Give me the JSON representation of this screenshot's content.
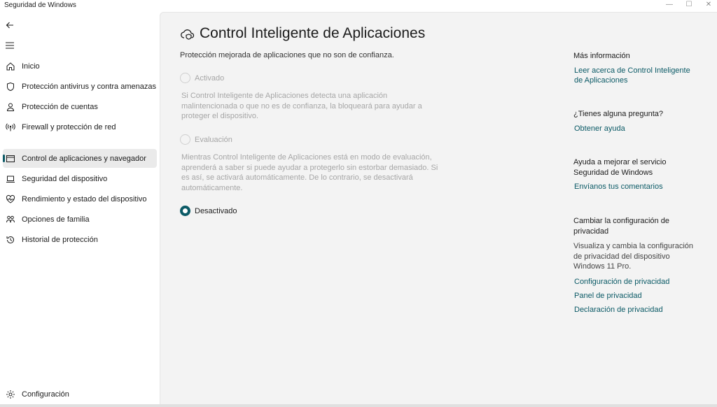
{
  "window": {
    "title": "Seguridad de Windows",
    "controls": {
      "minimize": "—",
      "maximize": "☐",
      "close": "✕"
    }
  },
  "sidebar": {
    "back_icon": "back-arrow-icon",
    "menu_icon": "hamburger-icon",
    "items": [
      {
        "label": "Inicio",
        "icon": "home-icon"
      },
      {
        "label": "Protección antivirus y contra amenazas",
        "icon": "shield-icon"
      },
      {
        "label": "Protección de cuentas",
        "icon": "person-icon"
      },
      {
        "label": "Firewall y protección de red",
        "icon": "antenna-icon"
      },
      {
        "label": "Control de aplicaciones y navegador",
        "icon": "app-browser-icon",
        "active": true
      },
      {
        "label": "Seguridad del dispositivo",
        "icon": "laptop-icon"
      },
      {
        "label": "Rendimiento y estado del dispositivo",
        "icon": "heart-pulse-icon"
      },
      {
        "label": "Opciones de familia",
        "icon": "family-icon"
      },
      {
        "label": "Historial de protección",
        "icon": "history-icon"
      }
    ],
    "settings": {
      "label": "Configuración",
      "icon": "gear-icon"
    }
  },
  "main": {
    "title": "Control Inteligente de Aplicaciones",
    "title_icon": "cloud-shield-icon",
    "subtitle": "Protección mejorada de aplicaciones que no son de confianza.",
    "options": [
      {
        "label": "Activado",
        "checked": false,
        "description": "Si Control Inteligente de Aplicaciones detecta una aplicación malintencionada o que no es de confianza, la bloqueará para ayudar a proteger el dispositivo."
      },
      {
        "label": "Evaluación",
        "checked": false,
        "description": "Mientras Control Inteligente de Aplicaciones está en modo de evaluación, aprenderá a saber si puede ayudar a protegerlo sin estorbar demasiado. Si es así, se activará automáticamente. De lo contrario, se desactivará automáticamente."
      },
      {
        "label": "Desactivado",
        "checked": true
      }
    ]
  },
  "right_panel": {
    "more_info": {
      "heading": "Más información",
      "link": "Leer acerca de Control Inteligente de Aplicaciones"
    },
    "question": {
      "heading": "¿Tienes alguna pregunta?",
      "link": "Obtener ayuda"
    },
    "improve": {
      "heading": "Ayuda a mejorar el servicio Seguridad de Windows",
      "link": "Envíanos tus comentarios"
    },
    "privacy": {
      "heading": "Cambiar la configuración de privacidad",
      "text": "Visualiza y cambia la configuración de privacidad del dispositivo Windows 11 Pro.",
      "links": [
        "Configuración de privacidad",
        "Panel de privacidad",
        "Declaración de privacidad"
      ]
    }
  },
  "colors": {
    "accent": "#0b5a66",
    "main_bg": "#f3f3f3",
    "sidebar_bg": "#ffffff",
    "disabled_text": "#a6a6a6"
  }
}
